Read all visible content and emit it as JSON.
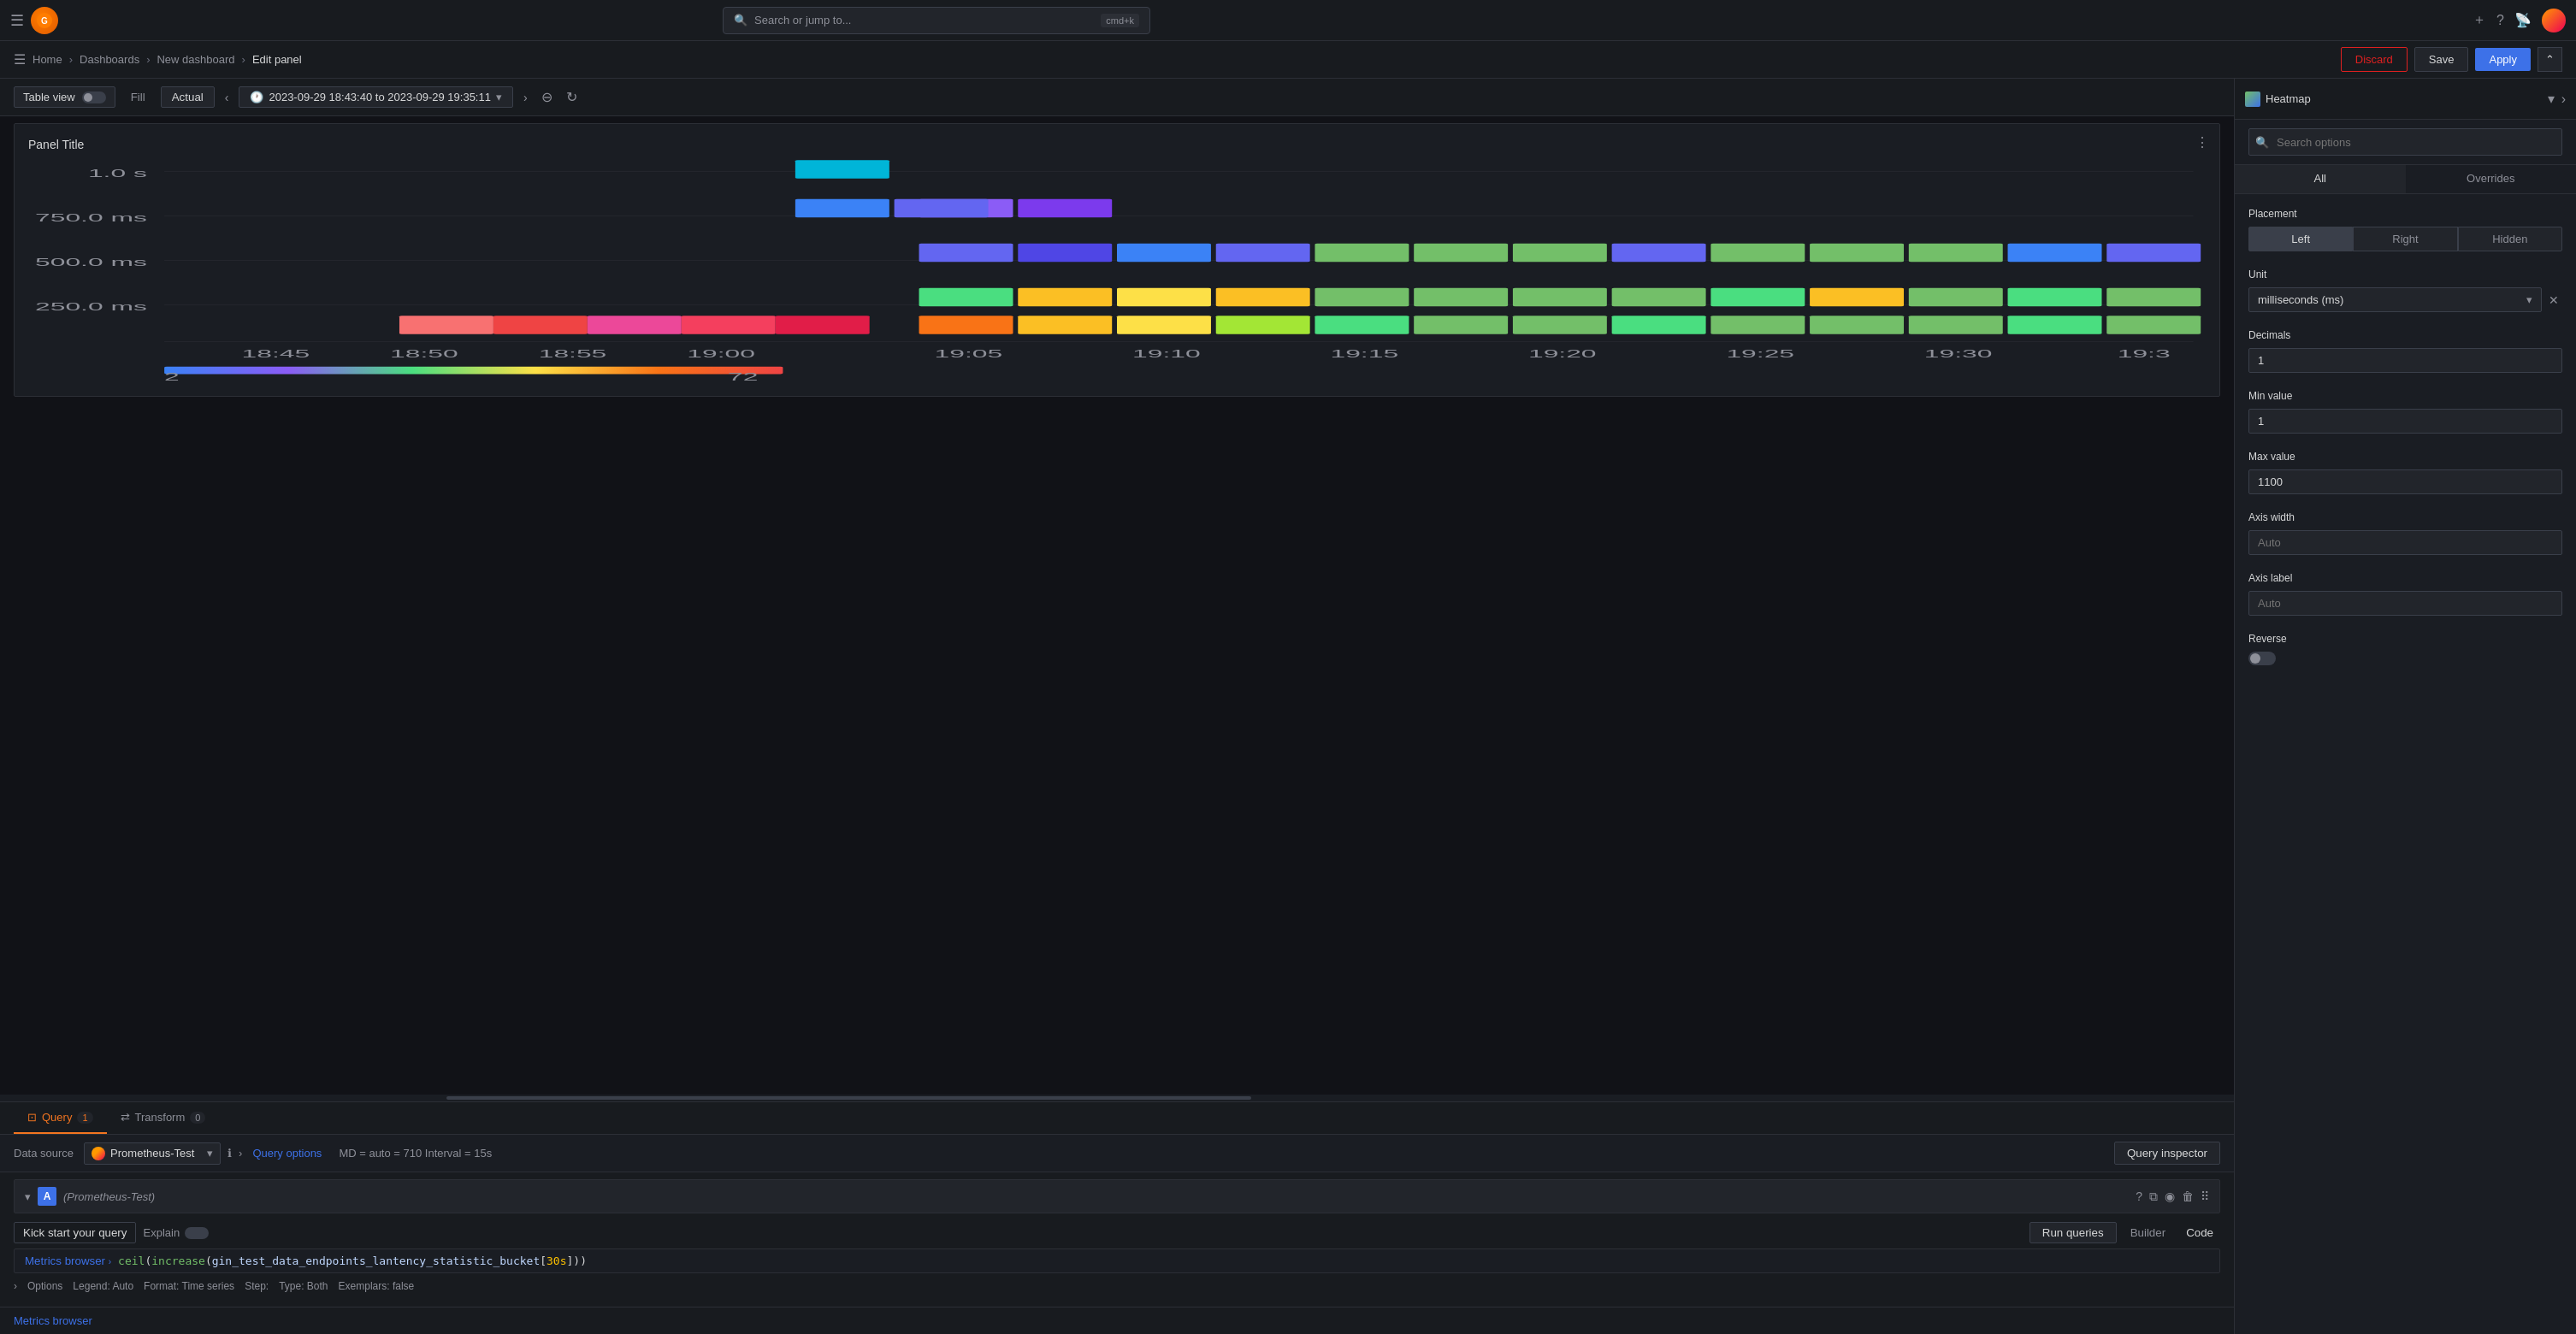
{
  "topnav": {
    "search_placeholder": "Search or jump to...",
    "search_shortcut": "cmd+k",
    "logo_text": "G"
  },
  "breadcrumb": {
    "home": "Home",
    "dashboards": "Dashboards",
    "new_dashboard": "New dashboard",
    "edit_panel": "Edit panel"
  },
  "buttons": {
    "discard": "Discard",
    "save": "Save",
    "apply": "Apply"
  },
  "chart_toolbar": {
    "table_view": "Table view",
    "fill": "Fill",
    "actual": "Actual",
    "time_range": "2023-09-29 18:43:40 to 2023-09-29 19:35:11"
  },
  "panel": {
    "title": "Panel Title"
  },
  "heatmap": {
    "y_labels": [
      "1.0 s",
      "750.0 ms",
      "500.0 ms",
      "250.0 ms"
    ],
    "x_labels": [
      "18:45",
      "18:50",
      "18:55",
      "19:00",
      "19:05",
      "19:10",
      "19:15",
      "19:20",
      "19:25",
      "19:30",
      "19:3"
    ],
    "legend_min": "2",
    "legend_max": "72"
  },
  "query_tabs": {
    "query_label": "Query",
    "query_count": "1",
    "transform_label": "Transform",
    "transform_count": "0"
  },
  "query_toolbar": {
    "data_source_label": "Data source",
    "data_source_name": "Prometheus-Test",
    "query_options_label": "Query options",
    "query_meta": "MD = auto = 710   Interval = 15s",
    "query_inspector_label": "Query inspector"
  },
  "query_editor": {
    "query_id": "A",
    "query_ds": "(Prometheus-Test)",
    "kick_start_label": "Kick start your query",
    "explain_label": "Explain",
    "run_queries_label": "Run queries",
    "builder_label": "Builder",
    "code_label": "Code",
    "metrics_browser_label": "Metrics browser",
    "query_text": "ceil(increase(gin_test_data_endpoints_lantency_statistic_bucket[30s]))",
    "options_label": "Options",
    "legend_label": "Legend: Auto",
    "format_label": "Format: Time series",
    "step_label": "Step:",
    "type_label": "Type: Both",
    "exemplars_label": "Exemplars: false"
  },
  "right_panel": {
    "visualization_label": "Heatmap",
    "search_placeholder": "Search options",
    "tabs": {
      "all": "All",
      "overrides": "Overrides"
    },
    "placement_label": "Placement",
    "placement_options": [
      "Left",
      "Right",
      "Hidden"
    ],
    "placement_active": "Left",
    "unit_label": "Unit",
    "unit_value": "milliseconds (ms)",
    "decimals_label": "Decimals",
    "decimals_value": "1",
    "min_value_label": "Min value",
    "min_value": "1",
    "max_value_label": "Max value",
    "max_value": "1100",
    "axis_width_label": "Axis width",
    "axis_width_value": "Auto",
    "axis_label_label": "Axis label",
    "axis_label_value": "Auto",
    "reverse_label": "Reverse"
  }
}
